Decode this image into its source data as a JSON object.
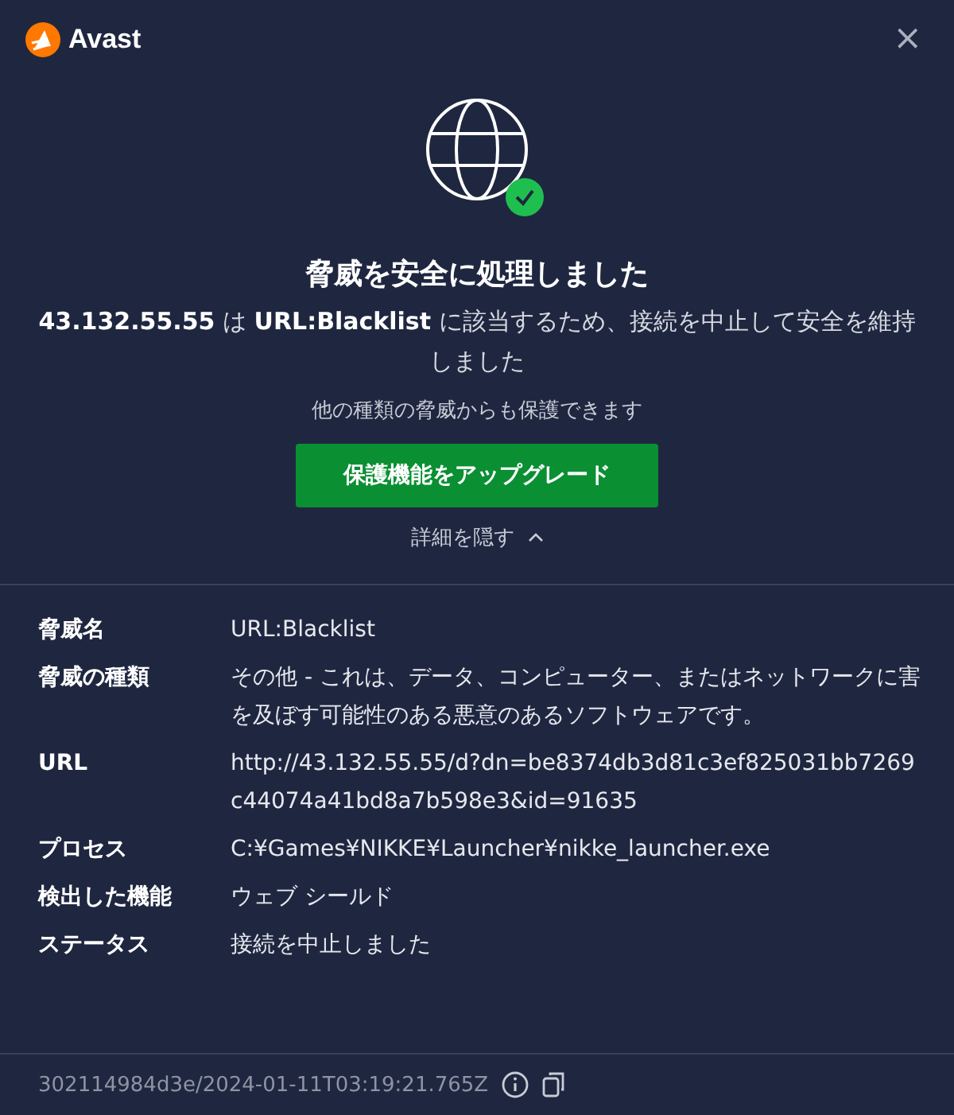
{
  "window": {
    "app_name": "Avast",
    "close": "×"
  },
  "result": {
    "title": "脅威を安全に処理しました",
    "message": "**43.132.55.55** は **URL:Blacklist** に該当するため、接続を中止して安全を維持しました",
    "note": "他の種類の脅威からも保護できます",
    "upgrade_button": "保護機能をアップグレード",
    "details_toggle": {
      "label": "詳細を隠す",
      "expanded": true
    }
  },
  "details": [
    {
      "label": "脅威名",
      "value": "URL:Blacklist"
    },
    {
      "label": "脅威の種類",
      "value": "その他 - これは、データ、コンピューター、またはネットワークに害を及ぼす可能性のある悪意のあるソフトウェアです。"
    },
    {
      "label": "URL",
      "value": "http://43.132.55.55/d?dn=be8374db3d81c3ef825031bb7269c44074a41bd8a7b598e3&id=91635"
    },
    {
      "label": "プロセス",
      "value": "C:¥Games¥NIKKE¥Launcher¥nikke_launcher.exe"
    },
    {
      "label": "検出した機能",
      "value": "ウェブ シールド"
    },
    {
      "label": "ステータス",
      "value": "接続を中止しました"
    }
  ],
  "footer": {
    "id": "302114984d3e/2024-01-11T03:19:21.765Z"
  }
}
